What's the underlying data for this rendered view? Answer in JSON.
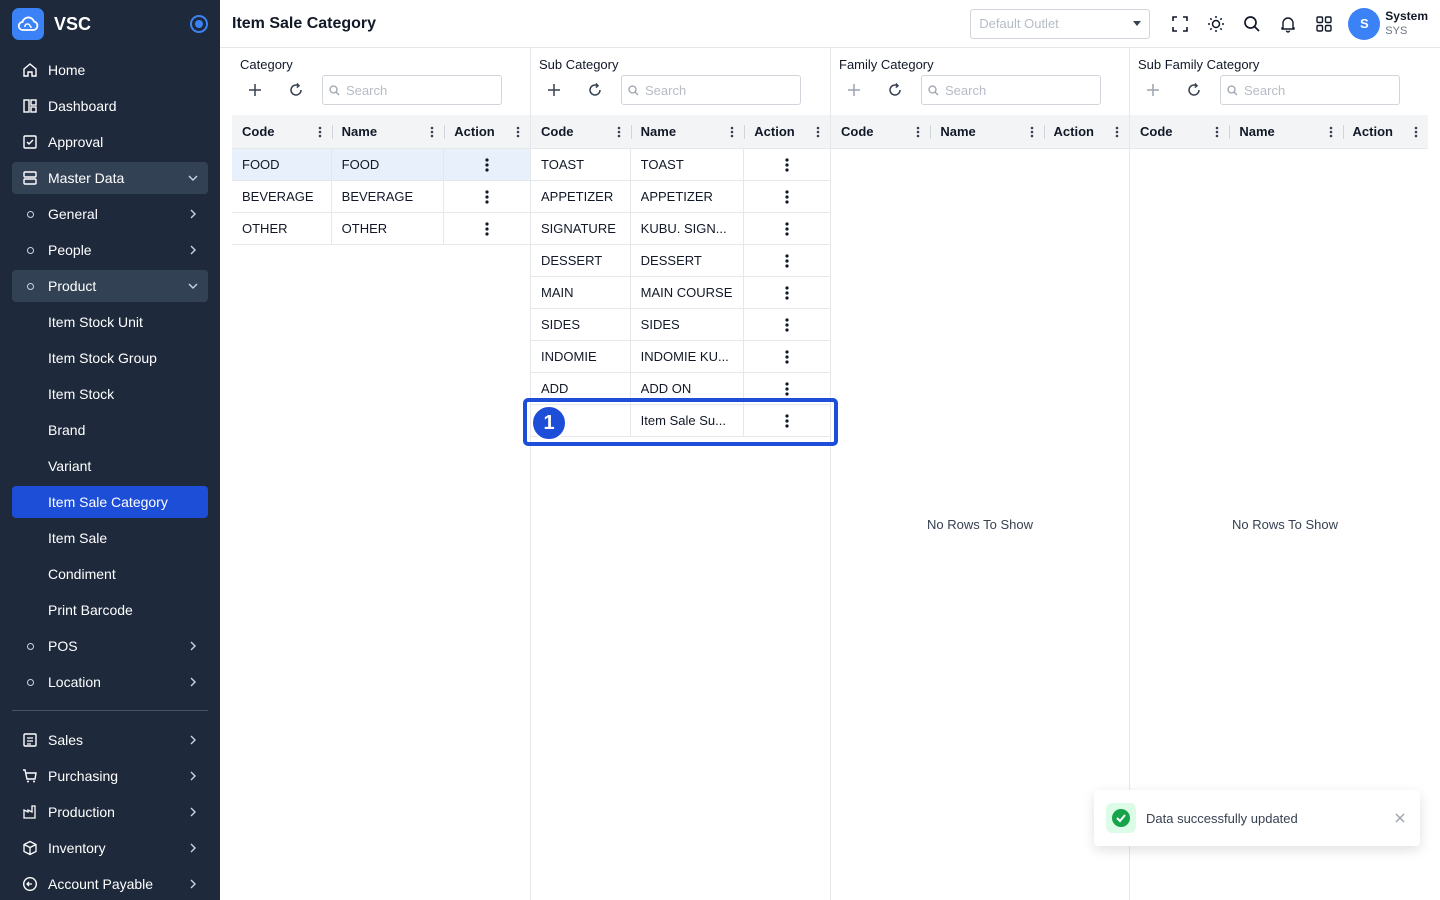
{
  "app": {
    "name": "VSC"
  },
  "sidebar": {
    "items": [
      {
        "label": "Home",
        "icon": "home-icon"
      },
      {
        "label": "Dashboard",
        "icon": "dashboard-icon"
      },
      {
        "label": "Approval",
        "icon": "approval-icon"
      },
      {
        "label": "Master Data",
        "icon": "database-icon"
      },
      {
        "label": "General"
      },
      {
        "label": "People"
      },
      {
        "label": "Product"
      },
      {
        "label": "Item Stock Unit"
      },
      {
        "label": "Item Stock Group"
      },
      {
        "label": "Item Stock"
      },
      {
        "label": "Brand"
      },
      {
        "label": "Variant"
      },
      {
        "label": "Item Sale Category"
      },
      {
        "label": "Item Sale"
      },
      {
        "label": "Condiment"
      },
      {
        "label": "Print Barcode"
      },
      {
        "label": "POS"
      },
      {
        "label": "Location"
      },
      {
        "label": "Sales",
        "icon": "sales-icon"
      },
      {
        "label": "Purchasing",
        "icon": "cart-icon"
      },
      {
        "label": "Production",
        "icon": "factory-icon"
      },
      {
        "label": "Inventory",
        "icon": "box-icon"
      },
      {
        "label": "Account Payable",
        "icon": "payable-icon"
      }
    ]
  },
  "header": {
    "title": "Item Sale Category",
    "outlet_placeholder": "Default Outlet",
    "user_name": "System",
    "user_code": "SYS",
    "avatar_initial": "S"
  },
  "panels": {
    "category": {
      "title": "Category",
      "search_placeholder": "Search",
      "columns": [
        "Code",
        "Name",
        "Action"
      ],
      "rows": [
        {
          "code": "FOOD",
          "name": "FOOD"
        },
        {
          "code": "BEVERAGE",
          "name": "BEVERAGE"
        },
        {
          "code": "OTHER",
          "name": "OTHER"
        }
      ]
    },
    "sub_category": {
      "title": "Sub Category",
      "search_placeholder": "Search",
      "columns": [
        "Code",
        "Name",
        "Action"
      ],
      "rows": [
        {
          "code": "TOAST",
          "name": "TOAST"
        },
        {
          "code": "APPETIZER",
          "name": "APPETIZER"
        },
        {
          "code": "SIGNATURE",
          "name": "KUBU. SIGN..."
        },
        {
          "code": "DESSERT",
          "name": "DESSERT"
        },
        {
          "code": "MAIN",
          "name": "MAIN COURSE"
        },
        {
          "code": "SIDES",
          "name": "SIDES"
        },
        {
          "code": "INDOMIE",
          "name": "INDOMIE KU..."
        },
        {
          "code": "ADD",
          "name": "ADD ON"
        },
        {
          "code": "",
          "name": "Item Sale Su..."
        }
      ]
    },
    "family_category": {
      "title": "Family Category",
      "search_placeholder": "Search",
      "columns": [
        "Code",
        "Name",
        "Action"
      ],
      "empty_text": "No Rows To Show"
    },
    "sub_family_category": {
      "title": "Sub Family Category",
      "search_placeholder": "Search",
      "columns": [
        "Code",
        "Name",
        "Action"
      ],
      "empty_text": "No Rows To Show"
    }
  },
  "annotation": {
    "badge": "1"
  },
  "toast": {
    "message": "Data successfully updated"
  },
  "colors": {
    "sidebar_bg": "#1e293b",
    "accent": "#1d4ed8",
    "success": "#16a34a"
  }
}
